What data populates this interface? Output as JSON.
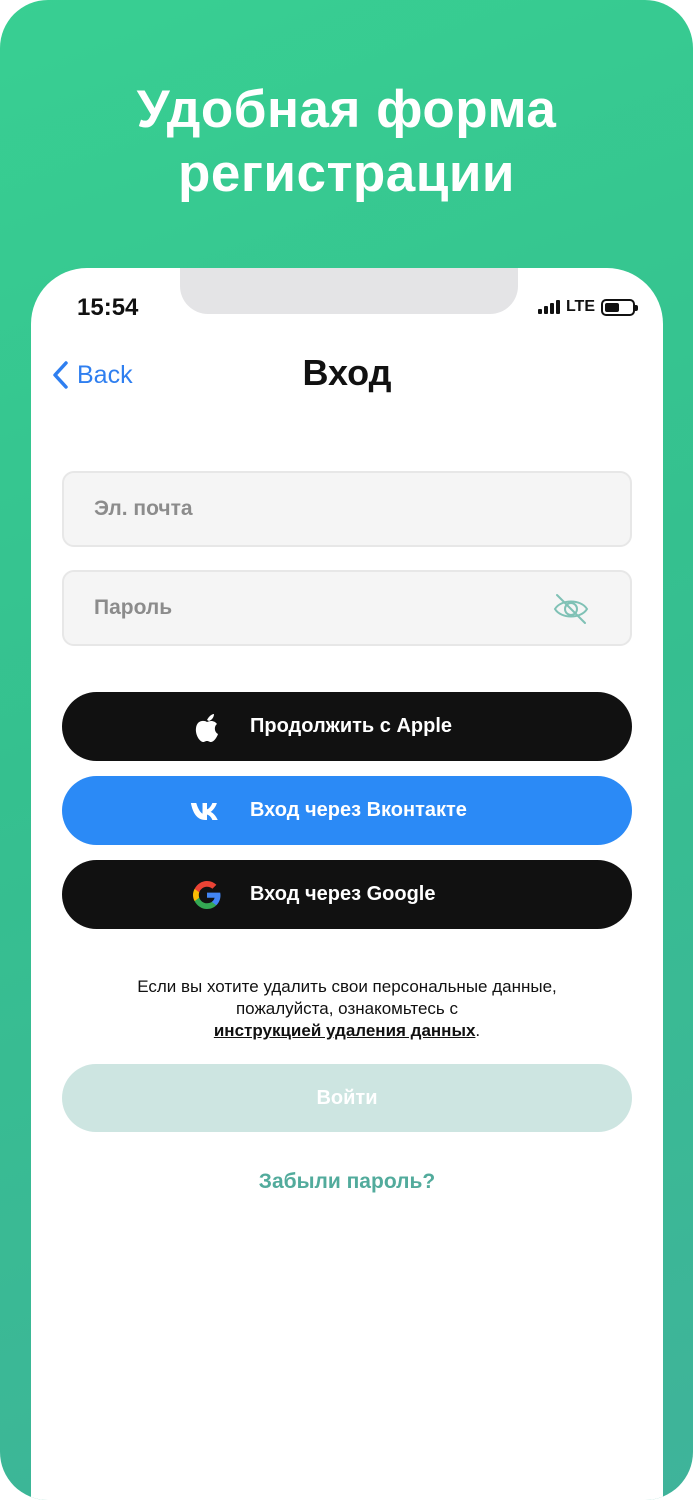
{
  "promo": {
    "headline_line1": "Удобная форма",
    "headline_line2": "регистрации",
    "background_color": "#38cf92"
  },
  "status_bar": {
    "time": "15:54",
    "network": "LTE",
    "icons": [
      "signal-icon",
      "battery-icon"
    ]
  },
  "nav": {
    "back_label": "Back",
    "title": "Вход",
    "back_icon": "chevron-left-icon",
    "accent_color": "#2f7ff0"
  },
  "form": {
    "email_placeholder": "Эл. почта",
    "email_value": "",
    "password_placeholder": "Пароль",
    "password_value": "",
    "password_toggle_icon": "eye-off-icon"
  },
  "social": {
    "apple_label": "Продолжить с Apple",
    "apple_icon": "apple-icon",
    "vk_label": "Вход через Вконтакте",
    "vk_icon": "vk-icon",
    "vk_color": "#2b8af6",
    "google_label": "Вход через Google",
    "google_icon": "google-icon"
  },
  "notice": {
    "line1": "Если вы хотите удалить свои персональные данные,",
    "line2": "пожалуйста, ознакомьтесь с",
    "link": "инструкцией удаления данных",
    "suffix": "."
  },
  "actions": {
    "login_label": "Войти",
    "login_color": "#cde5e1",
    "forgot_label": "Забыли пароль?",
    "forgot_color": "#52ab9c"
  }
}
